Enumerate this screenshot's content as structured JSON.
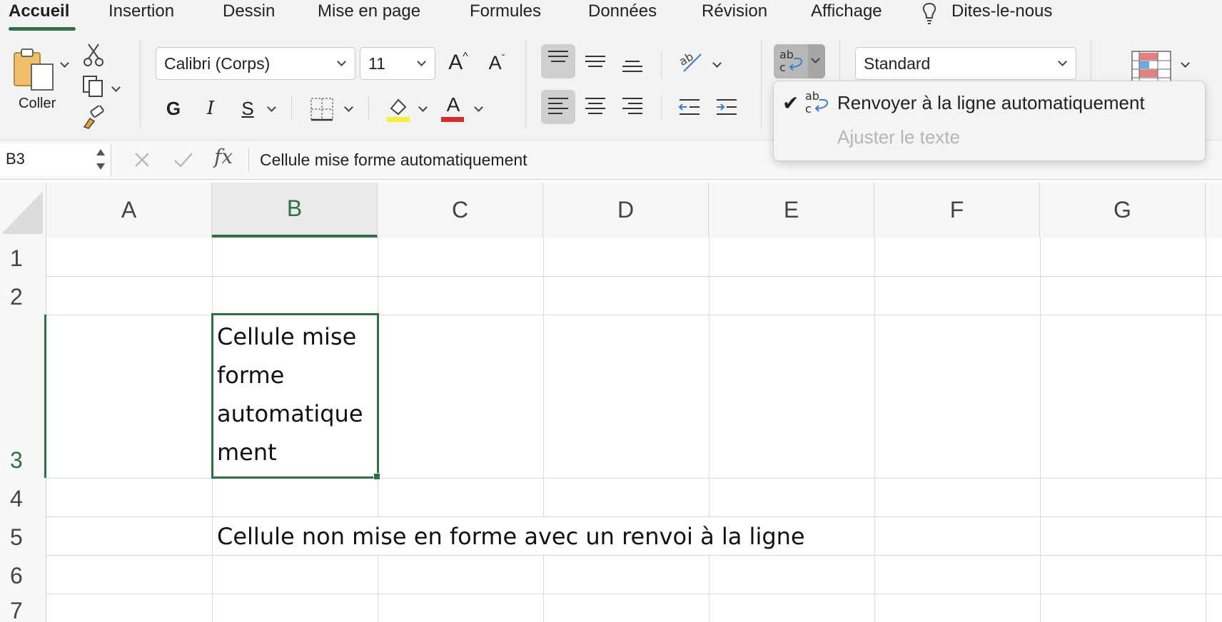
{
  "ribbon_tabs": [
    {
      "label": "Accueil"
    },
    {
      "label": "Insertion"
    },
    {
      "label": "Dessin"
    },
    {
      "label": "Mise en page"
    },
    {
      "label": "Formules"
    },
    {
      "label": "Données"
    },
    {
      "label": "Révision"
    },
    {
      "label": "Affichage"
    },
    {
      "label": "Dites-le-nous"
    }
  ],
  "clipboard": {
    "paste_label": "Coller"
  },
  "font": {
    "family": "Calibri (Corps)",
    "size": "11",
    "bold_label": "G",
    "italic_label": "I",
    "underline_label": "S",
    "grow_label": "A",
    "shrink_label": "A",
    "color_label": "A",
    "fill_color": "#f6ef3a",
    "font_color": "#d92b2b"
  },
  "wrap_button": {
    "label": "ab c"
  },
  "number_format": {
    "value": "Standard"
  },
  "formula_bar": {
    "cell_ref": "B3",
    "fx_label": "fx",
    "content": "Cellule mise forme automatiquement"
  },
  "sheet": {
    "columns": [
      "A",
      "B",
      "C",
      "D",
      "E",
      "F",
      "G"
    ],
    "rows": [
      "1",
      "2",
      "3",
      "4",
      "5",
      "6",
      "7"
    ],
    "selected_cell": "B3",
    "cells": {
      "B3_lines": [
        "Cellule mise",
        "forme",
        "automatique",
        "ment"
      ],
      "B5": "Cellule non mise en forme avec un renvoi à la ligne"
    }
  },
  "wrap_menu": {
    "items": [
      {
        "label": "Renvoyer à la ligne automatiquement",
        "checked": true,
        "enabled": true
      },
      {
        "label": "Ajuster le texte",
        "checked": false,
        "enabled": false
      }
    ]
  },
  "colors": {
    "accent": "#2f6f46",
    "ribbon_bg": "#f3f3f3"
  }
}
